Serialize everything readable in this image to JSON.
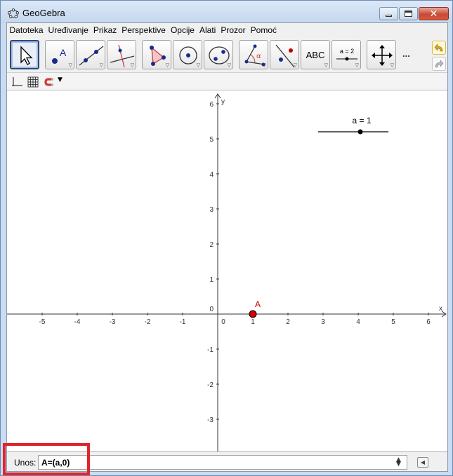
{
  "window": {
    "title": "GeoGebra"
  },
  "menu": [
    "Datoteka",
    "Uređivanje",
    "Prikaz",
    "Perspektive",
    "Opcije",
    "Alati",
    "Prozor",
    "Pomoć"
  ],
  "toolbar": {
    "tools": [
      {
        "name": "move-tool"
      },
      {
        "name": "point-tool"
      },
      {
        "name": "line-tool"
      },
      {
        "name": "perpendicular-line-tool"
      },
      {
        "name": "polygon-tool"
      },
      {
        "name": "circle-tool"
      },
      {
        "name": "conic-tool"
      },
      {
        "name": "angle-tool"
      },
      {
        "name": "reflect-tool"
      },
      {
        "name": "text-tool",
        "label": "ABC"
      },
      {
        "name": "slider-tool",
        "label": "a = 2"
      },
      {
        "name": "move-graphics-view-tool"
      }
    ],
    "more_label": "..."
  },
  "graphics": {
    "x_axis_name": "x",
    "y_axis_name": "y",
    "x_ticks": [
      "-5",
      "-4",
      "-3",
      "-2",
      "-1",
      "0",
      "1",
      "2",
      "3",
      "4",
      "5",
      "6"
    ],
    "y_ticks": [
      "6",
      "5",
      "4",
      "3",
      "2",
      "1",
      "0",
      "-1",
      "-2",
      "-3"
    ],
    "slider": {
      "label": "a = 1",
      "value": 1
    },
    "point": {
      "label": "A",
      "x": 1,
      "y": 0,
      "color": "#c00000"
    }
  },
  "input_bar": {
    "label": "Unos:",
    "value": "A=(a,0)"
  },
  "colors": {
    "point_fill": "#d40000",
    "highlight": "#e0242c",
    "axis": "#333333"
  }
}
